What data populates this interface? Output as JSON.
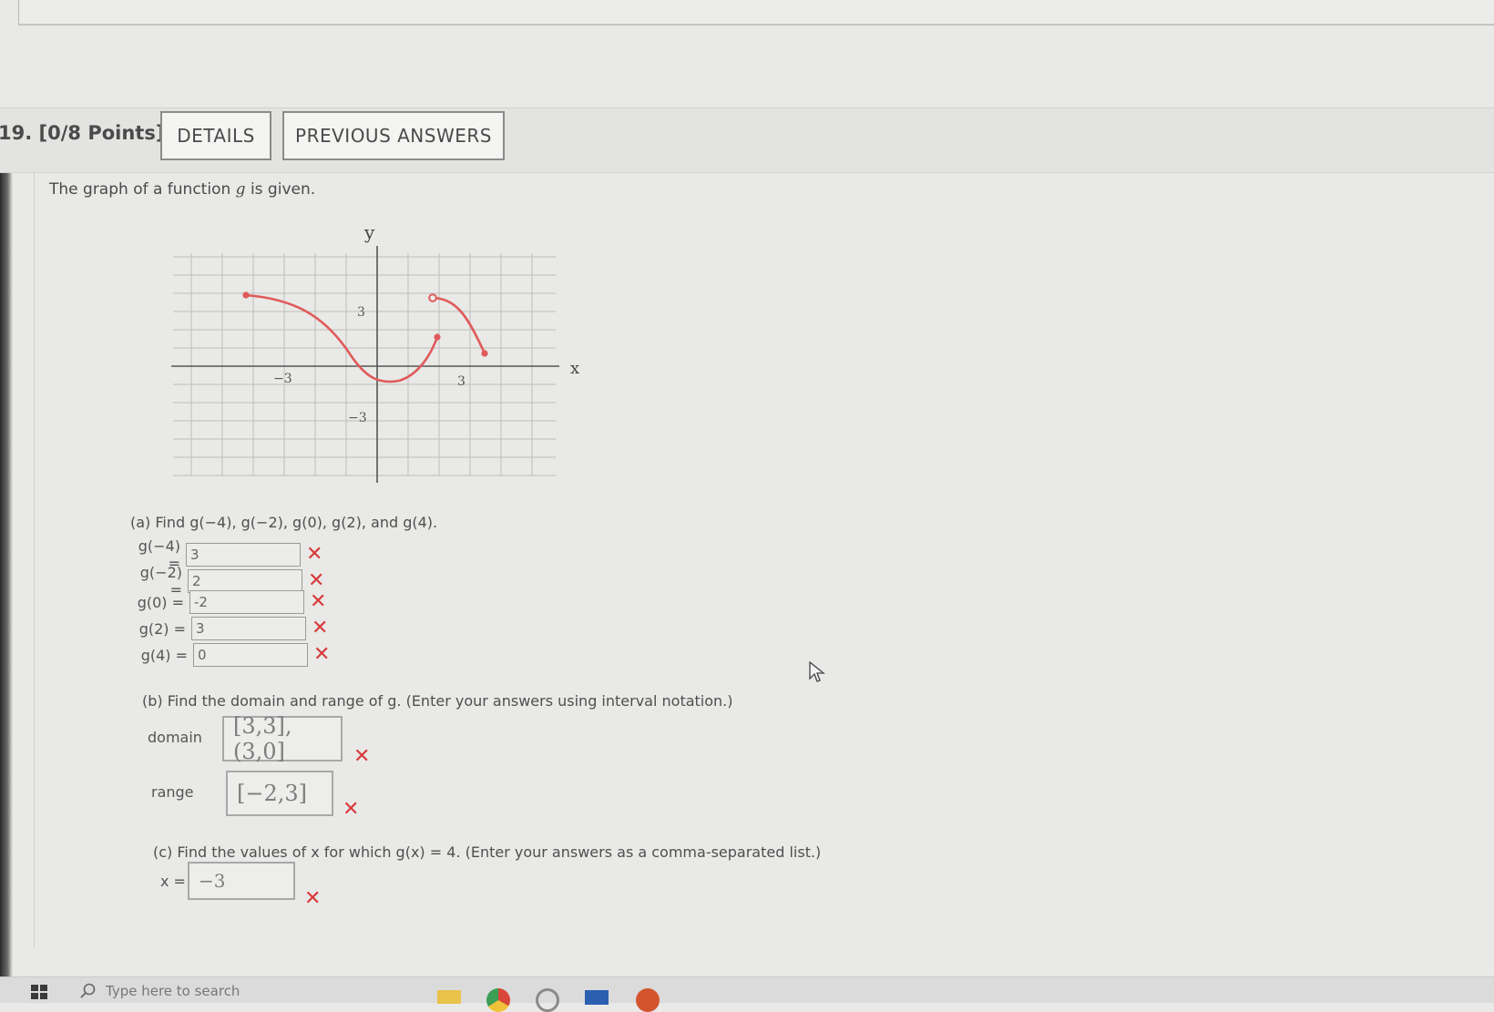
{
  "question": {
    "number": "19.",
    "points": "[0/8 Points]",
    "details_button": "DETAILS",
    "previous_answers_button": "PREVIOUS ANSWERS",
    "intro_prefix": "The graph of a function",
    "intro_var": "g",
    "intro_suffix": "is given."
  },
  "graph": {
    "y_axis_label": "y",
    "x_axis_label": "x",
    "tick_neg3_x": "−3",
    "tick_pos3_x": "3",
    "tick_pos3_y": "3",
    "tick_neg3_y": "−3",
    "curve_color": "#e05a5a"
  },
  "part_a": {
    "title": "(a) Find g(−4), g(−2), g(0), g(2), and g(4).",
    "rows": [
      {
        "label": "g(−4) =",
        "value": "3"
      },
      {
        "label": "g(−2) =",
        "value": "2"
      },
      {
        "label": "g(0) =",
        "value": "-2"
      },
      {
        "label": "g(2) =",
        "value": "3"
      },
      {
        "label": "g(4) =",
        "value": "0"
      }
    ]
  },
  "part_b": {
    "title": "(b) Find the domain and range of g. (Enter your answers using interval notation.)",
    "domain_label": "domain",
    "domain_value": "[3,3],(3,0]",
    "range_label": "range",
    "range_value": "[−2,3]"
  },
  "part_c": {
    "title": "(c) Find the values of x for which g(x) = 4. (Enter your answers as a comma-separated list.)",
    "x_label": "x =",
    "x_value": "−3"
  },
  "incorrect_mark": "✕",
  "taskbar": {
    "search_placeholder": "Type here to search"
  },
  "colors": {
    "incorrect": "#d83a3a",
    "curve": "#e05a5a"
  }
}
